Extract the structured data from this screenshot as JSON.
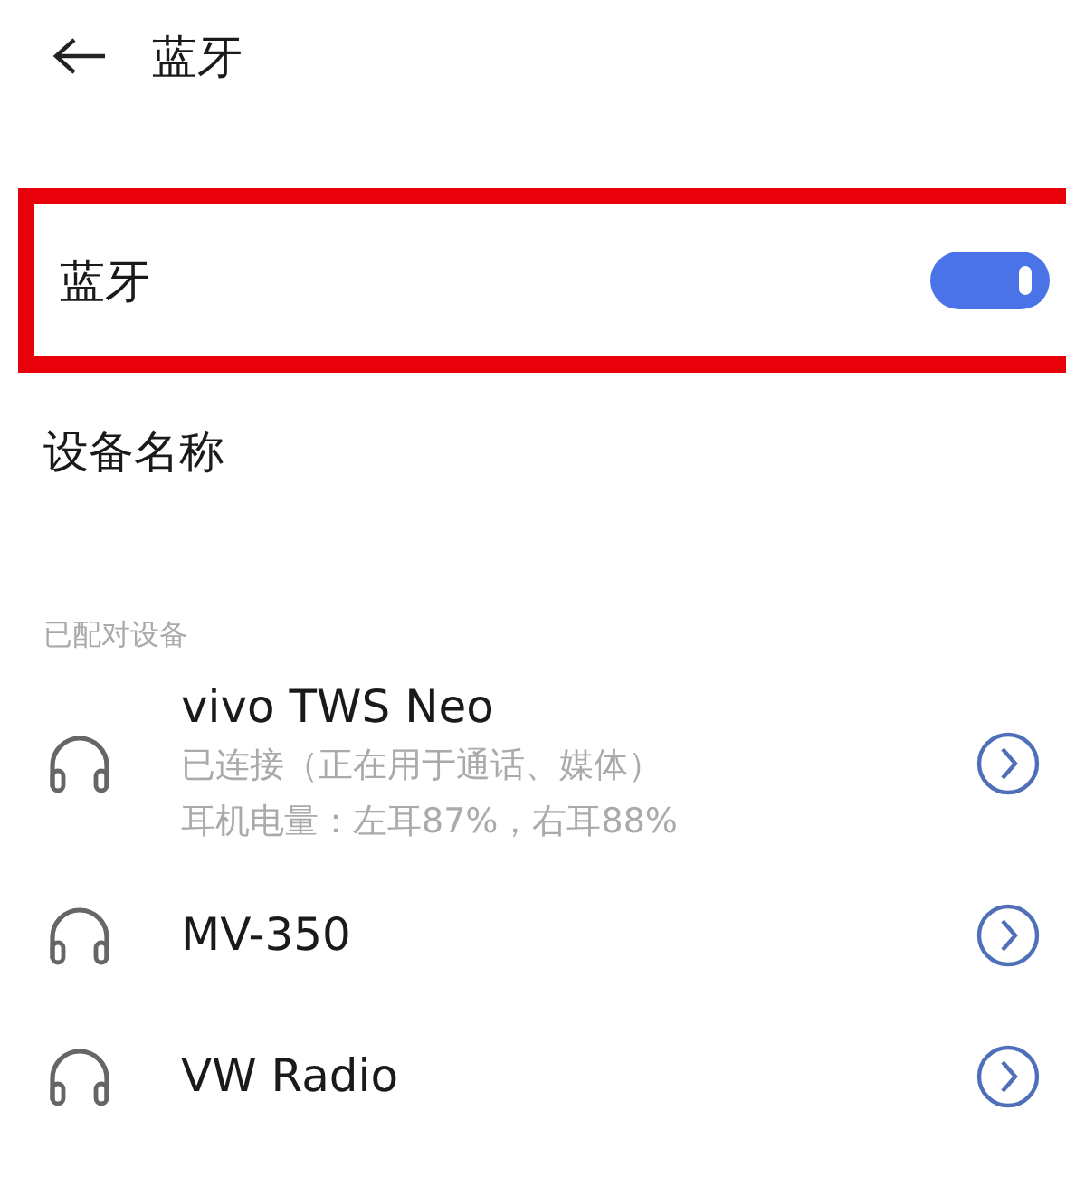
{
  "header": {
    "title": "蓝牙"
  },
  "bluetooth": {
    "label": "蓝牙",
    "on": true,
    "highlighted": true
  },
  "device_name": {
    "label": "设备名称"
  },
  "paired_section": {
    "title": "已配对设备",
    "devices": [
      {
        "name": "vivo TWS Neo",
        "details": [
          "已连接（正在用于通话、媒体）",
          "耳机电量：左耳87%，右耳88%"
        ]
      },
      {
        "name": "MV-350"
      },
      {
        "name": "VW Radio"
      }
    ]
  }
}
